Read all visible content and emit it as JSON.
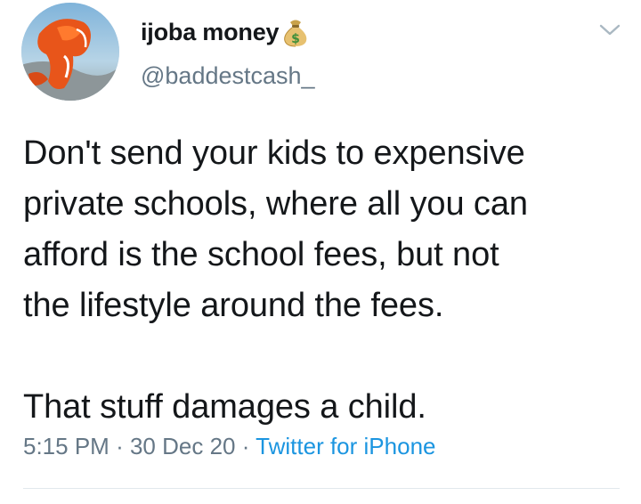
{
  "author": {
    "display_name": "ijoba money",
    "name_emoji": "money-bag-icon",
    "handle": "@baddestcash_"
  },
  "tweet": {
    "text_paragraph_1": "Don't send your kids to expensive\nprivate schools, where all you can\nafford is the school fees, but not\nthe lifestyle around the fees.",
    "text_paragraph_2": "That stuff damages a child."
  },
  "meta": {
    "time": "5:15 PM",
    "separator": "·",
    "date": "30 Dec 20",
    "source": "Twitter for iPhone"
  },
  "colors": {
    "text": "#14171a",
    "secondary": "#657786",
    "link": "#1b95e0",
    "divider": "#e1e8ed"
  }
}
